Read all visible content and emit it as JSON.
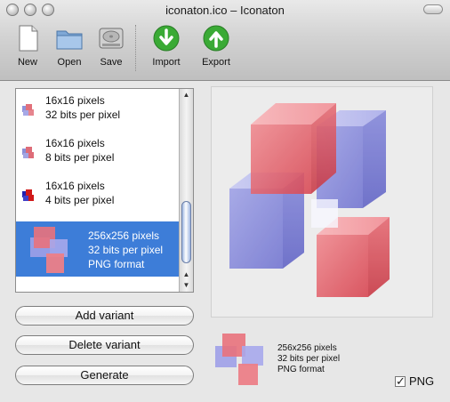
{
  "window": {
    "title": "iconaton.ico – Iconaton"
  },
  "toolbar": {
    "new_label": "New",
    "open_label": "Open",
    "save_label": "Save",
    "import_label": "Import",
    "export_label": "Export"
  },
  "variants": [
    {
      "line1": "16x16 pixels",
      "line2": "32 bits per pixel",
      "line3": ""
    },
    {
      "line1": "16x16 pixels",
      "line2": "8 bits per pixel",
      "line3": ""
    },
    {
      "line1": "16x16 pixels",
      "line2": "4 bits per pixel",
      "line3": ""
    },
    {
      "line1": "256x256 pixels",
      "line2": "32 bits per pixel",
      "line3": "PNG format",
      "selected": true
    }
  ],
  "buttons": {
    "add": "Add variant",
    "delete": "Delete variant",
    "generate": "Generate"
  },
  "preview_info": {
    "line1": "256x256 pixels",
    "line2": "32 bits per pixel",
    "line3": "PNG format"
  },
  "png_checkbox": {
    "label": "PNG",
    "checked": true
  },
  "colors": {
    "selection": "#3d7dd8",
    "red_cube": "#e85b64",
    "blue_cube": "#6f74d6"
  }
}
